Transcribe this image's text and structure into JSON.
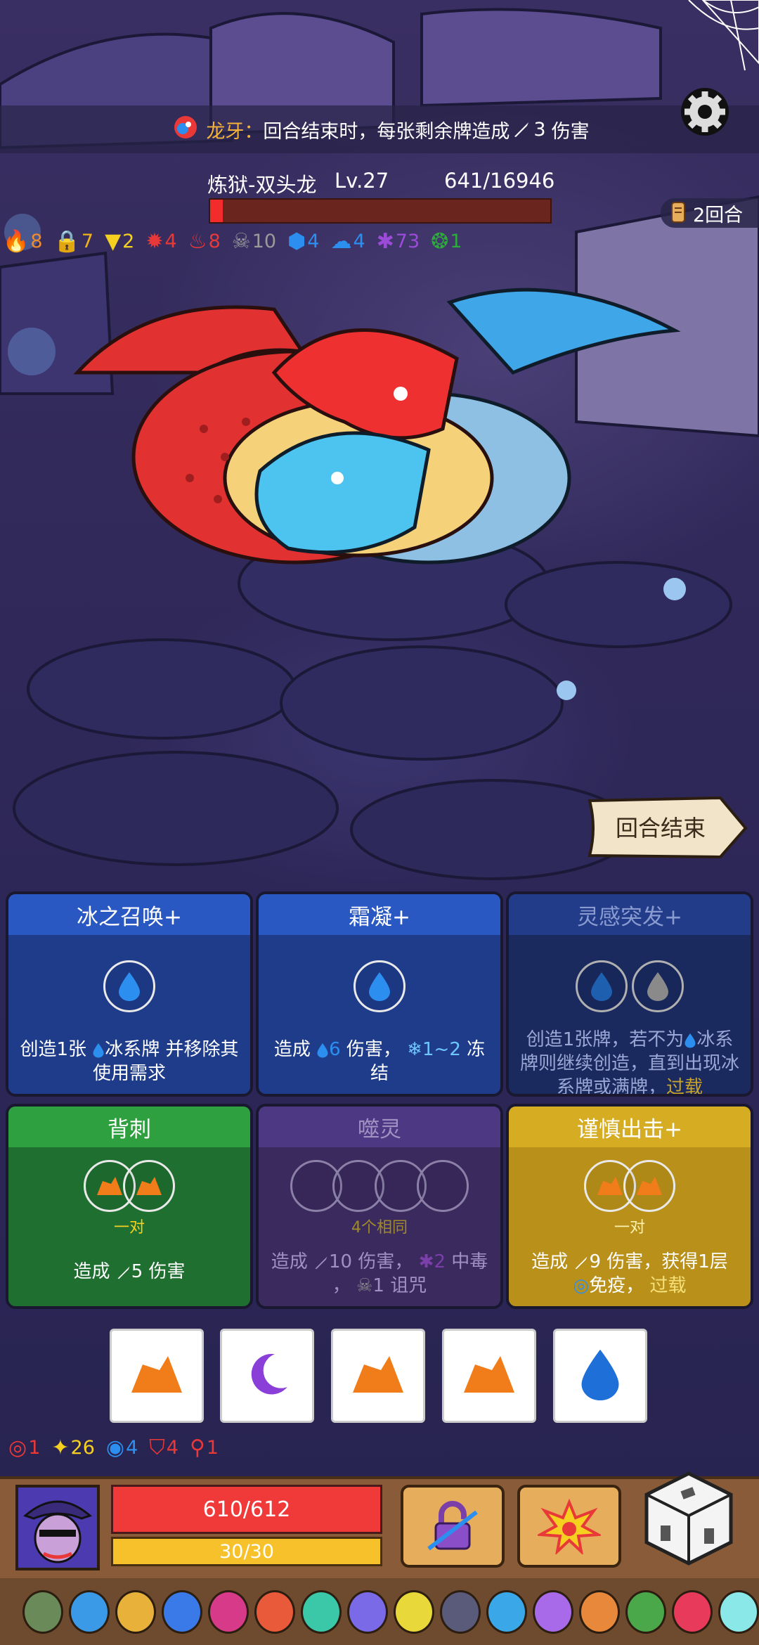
{
  "ability": {
    "name": "龙牙",
    "colon": "：",
    "text": "回合结束时，每张剩余牌造成",
    "damage": "3",
    "suffix": "伤害"
  },
  "boss": {
    "name": "炼狱-双头龙",
    "level": "Lv.27",
    "hp_text": "641/16946",
    "hp_current": 641,
    "hp_max": 16946
  },
  "turn": {
    "label": "2回合"
  },
  "boss_status": [
    {
      "icon": "fire-icon",
      "value": "8",
      "color": "#f08a2a"
    },
    {
      "icon": "lock-icon",
      "value": "7",
      "color": "#f0b21a"
    },
    {
      "icon": "triangle-icon",
      "value": "2",
      "color": "#f5d020"
    },
    {
      "icon": "rage-icon",
      "value": "4",
      "color": "#e83838"
    },
    {
      "icon": "flame-red-icon",
      "value": "8",
      "color": "#e83838"
    },
    {
      "icon": "skull-icon",
      "value": "10",
      "color": "#9a9a9a"
    },
    {
      "icon": "shield-hex-icon",
      "value": "4",
      "color": "#2c8ff0"
    },
    {
      "icon": "ghost-icon",
      "value": "4",
      "color": "#2c8ff0"
    },
    {
      "icon": "splat-icon",
      "value": "73",
      "color": "#9b4bd8"
    },
    {
      "icon": "spiral-icon",
      "value": "1",
      "color": "#2eaa3c"
    }
  ],
  "end_turn": {
    "label": "回合结束"
  },
  "cards": [
    {
      "title": "冰之召唤+",
      "p1": "创造1张",
      "p2": "冰系牌 并移除其使用需求"
    },
    {
      "title": "霜凝+",
      "p1": "造成",
      "dmg": "6",
      "p2": "伤害，",
      "freeze": "1~2",
      "p3": "冻结"
    },
    {
      "title": "灵感突发+",
      "p1": "创造1张牌，若不为",
      "p2": "冰系牌则继续创造，直到出现冰系牌或满牌，",
      "overload": "过载"
    },
    {
      "title": "背刺",
      "req": "一对",
      "p1": "造成",
      "dmg": "5",
      "p2": "伤害"
    },
    {
      "title": "噬灵",
      "req": "4个相同",
      "p1": "造成",
      "dmg": "10",
      "p2": "伤害，",
      "poison": "2",
      "p3": "中毒",
      "comma": "，",
      "curse": "1",
      "p4": "诅咒"
    },
    {
      "title": "谨慎出击+",
      "req": "一对",
      "p1": "造成",
      "dmg": "9",
      "p2": "伤害，获得1层",
      "immune": "免疫",
      "comma": "，",
      "overload": "过载"
    }
  ],
  "hand": [
    {
      "icon": "rock-icon"
    },
    {
      "icon": "moon-icon"
    },
    {
      "icon": "rock-icon"
    },
    {
      "icon": "rock-icon"
    },
    {
      "icon": "water-drop-icon"
    }
  ],
  "player_status": [
    {
      "icon": "target-icon",
      "value": "1",
      "color": "#e83838"
    },
    {
      "icon": "spark-icon",
      "value": "26",
      "color": "#f5d020"
    },
    {
      "icon": "eye-ring-icon",
      "value": "4",
      "color": "#2c8ff0"
    },
    {
      "icon": "shield-icon",
      "value": "4",
      "color": "#e83838"
    },
    {
      "icon": "hook-icon",
      "value": "1",
      "color": "#e83838"
    }
  ],
  "player": {
    "hp_text": "610/612",
    "mp_text": "30/30"
  },
  "colors": {
    "accent": "#f5b23a",
    "hp": "#f03a3a",
    "mp": "#f6c12a",
    "water": "#2c8ff0"
  }
}
